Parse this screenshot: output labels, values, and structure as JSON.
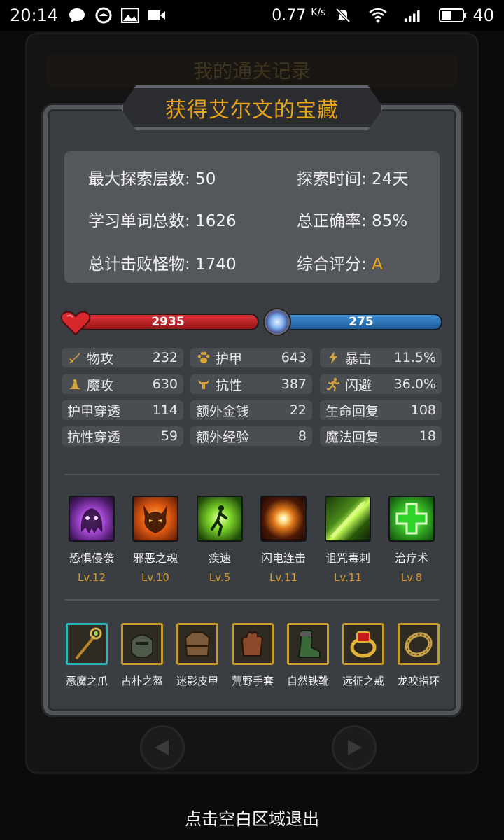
{
  "status_bar": {
    "time": "20:14",
    "speed": "0.77",
    "speed_unit": "K/s",
    "battery": "40",
    "icons": [
      "chat-bubble-icon",
      "circle-app-icon",
      "image-icon",
      "video-icon",
      "mute-icon",
      "wifi-icon",
      "signal-icon",
      "battery-icon"
    ]
  },
  "background_title": "我的通关记录",
  "title": "获得艾尔文的宝藏",
  "summary": {
    "max_floor": "最大探索层数: 50",
    "explore_time": "探索时间: 24天",
    "total_words": "学习单词总数: 1626",
    "accuracy": "总正确率: 85%",
    "monsters": "总计击败怪物: 1740",
    "rating_label": "综合评分: ",
    "rating_value": "A"
  },
  "hp": {
    "value": "2935",
    "color": "#c42428"
  },
  "mp": {
    "value": "275",
    "color": "#2f74b8"
  },
  "stats": [
    {
      "label": "物攻",
      "value": "232",
      "icon": "sword-icon"
    },
    {
      "label": "护甲",
      "value": "643",
      "icon": "paw-icon"
    },
    {
      "label": "暴击",
      "value": "11.5%",
      "icon": "lightning-icon"
    },
    {
      "label": "魔攻",
      "value": "630",
      "icon": "wizard-hat-icon"
    },
    {
      "label": "抗性",
      "value": "387",
      "icon": "horns-icon"
    },
    {
      "label": "闪避",
      "value": "36.0%",
      "icon": "running-icon"
    },
    {
      "label": "护甲穿透",
      "value": "114"
    },
    {
      "label": "额外金钱",
      "value": "22"
    },
    {
      "label": "生命回复",
      "value": "108"
    },
    {
      "label": "抗性穿透",
      "value": "59"
    },
    {
      "label": "额外经验",
      "value": "8"
    },
    {
      "label": "魔法回复",
      "value": "18"
    }
  ],
  "skills": [
    {
      "name": "恐惧侵袭",
      "level": "Lv.12",
      "icon": "fear-ghost-icon"
    },
    {
      "name": "邪恶之魂",
      "level": "Lv.10",
      "icon": "evil-soul-icon"
    },
    {
      "name": "疾速",
      "level": "Lv.5",
      "icon": "haste-icon"
    },
    {
      "name": "闪电连击",
      "level": "Lv.11",
      "icon": "lightning-strike-icon"
    },
    {
      "name": "诅咒毒刺",
      "level": "Lv.11",
      "icon": "poison-thorn-icon"
    },
    {
      "name": "治疗术",
      "level": "Lv.8",
      "icon": "heal-cross-icon"
    }
  ],
  "equipment": [
    {
      "name": "恶魔之爪",
      "icon": "staff-icon"
    },
    {
      "name": "古朴之盔",
      "icon": "helmet-icon"
    },
    {
      "name": "迷影皮甲",
      "icon": "leather-armor-icon"
    },
    {
      "name": "荒野手套",
      "icon": "gloves-icon"
    },
    {
      "name": "自然铁靴",
      "icon": "boots-icon"
    },
    {
      "name": "远征之戒",
      "icon": "ruby-ring-icon"
    },
    {
      "name": "龙咬指环",
      "icon": "dragon-ring-icon"
    }
  ],
  "exit_hint": "点击空白区域退出"
}
